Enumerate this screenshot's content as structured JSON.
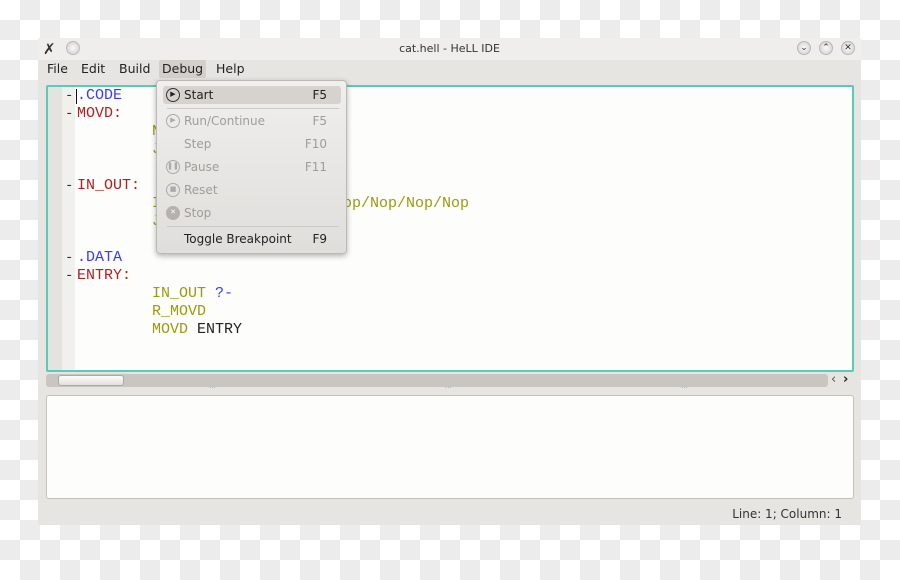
{
  "window": {
    "title": "cat.hell - HeLL IDE",
    "buttons": {
      "minimize": "⌄",
      "maximize": "⌃",
      "close": "✕"
    }
  },
  "menubar": [
    "File",
    "Edit",
    "Build",
    "Debug",
    "Help"
  ],
  "editor": {
    "lines": [
      {
        "text": ".CODE",
        "color": "blue",
        "fold": "-"
      },
      {
        "text": "MOVD:",
        "color": "red",
        "fold": "-"
      },
      {
        "text": "N",
        "color": "olive"
      },
      {
        "text": "J",
        "color": "olive"
      },
      {
        "text": "IN_OUT:",
        "color": "red",
        "fold": "-"
      },
      {
        "text": "I",
        "color": "olive",
        "trail": "op/Nop/Nop/Nop"
      },
      {
        "text": "J",
        "color": "olive"
      },
      {
        "text": ".DATA",
        "color": "blue",
        "fold": "-"
      },
      {
        "text": "ENTRY:",
        "color": "red",
        "fold": "-"
      },
      {
        "text": "IN_OUT",
        "color": "olive",
        "extra": "?-",
        "extra_color": "blue"
      },
      {
        "text": "R_MOVD",
        "color": "olive"
      },
      {
        "text": "MOVD",
        "color": "olive",
        "extra": "ENTRY",
        "extra_color": "black"
      }
    ]
  },
  "debug_menu": [
    {
      "label": "Start",
      "shortcut": "F5",
      "icon": "play-icon",
      "enabled": true,
      "highlighted": true
    },
    {
      "label": "Run/Continue",
      "shortcut": "F5",
      "icon": "play-icon",
      "enabled": false
    },
    {
      "label": "Step",
      "shortcut": "F10",
      "enabled": false
    },
    {
      "label": "Pause",
      "shortcut": "F11",
      "icon": "pause-icon",
      "enabled": false
    },
    {
      "label": "Reset",
      "shortcut": "",
      "icon": "stop-square-icon",
      "enabled": false
    },
    {
      "label": "Stop",
      "shortcut": "",
      "icon": "close-circle-icon",
      "enabled": false
    },
    {
      "label": "Toggle Breakpoint",
      "shortcut": "F9",
      "enabled": true
    }
  ],
  "status": "Line: 1; Column: 1",
  "colors": {
    "accent": "#5ccab9",
    "keyword_blue": "#3a3aff",
    "label_red": "#b02020",
    "instr_olive": "#9a9a10"
  }
}
